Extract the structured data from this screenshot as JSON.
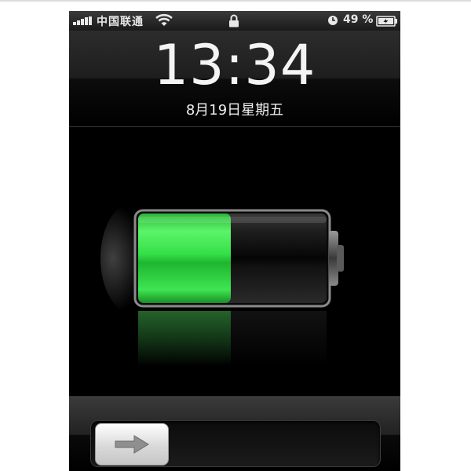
{
  "status_bar": {
    "carrier": "中国联通",
    "battery_percent": "49 %",
    "icons": [
      "signal-bars-icon",
      "wifi-icon",
      "lock-icon",
      "clock-icon",
      "charging-battery-icon"
    ]
  },
  "lock_screen": {
    "time": "13:34",
    "date": "8月19日星期五"
  },
  "battery": {
    "charge_level": 0.49,
    "fill_color": "#3be04a",
    "state": "charging"
  },
  "slider": {
    "knob_icon": "arrow-right-icon"
  },
  "colors": {
    "background": "#000000",
    "text": "#f4f4f4",
    "battery_green": "#3be04a"
  }
}
